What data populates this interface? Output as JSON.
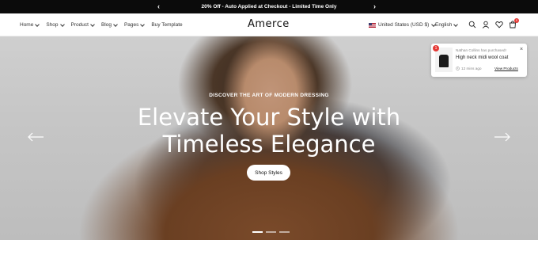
{
  "announcement": {
    "text": "20% Off - Auto Applied at Checkout - Limited Time Only",
    "prev_icon": "chevron-left-icon",
    "next_icon": "chevron-right-icon"
  },
  "nav": {
    "menu": [
      {
        "label": "Home",
        "dropdown": true
      },
      {
        "label": "Shop",
        "dropdown": true
      },
      {
        "label": "Product",
        "dropdown": true
      },
      {
        "label": "Blog",
        "dropdown": true
      },
      {
        "label": "Pages",
        "dropdown": true
      },
      {
        "label": "Buy Template",
        "dropdown": false
      }
    ],
    "logo": "Amerce",
    "currency": "United States (USD $)",
    "language": "English",
    "cart_count": "0",
    "icons": [
      "search-icon",
      "user-icon",
      "heart-icon",
      "cart-icon"
    ]
  },
  "hero": {
    "eyebrow": "DISCOVER THE ART OF MODERN DRESSING",
    "title_line1": "Elevate Your Style with",
    "title_line2": "Timeless Elegance",
    "cta": "Shop Styles",
    "slide_count": 3,
    "active_slide": 1
  },
  "toast": {
    "badge": "1",
    "buyer_line": "Nathan Collins has purchased!",
    "product": "High neck midi wool coat",
    "time_ago": "12 mins ago",
    "view_link": "View Products",
    "close": "×"
  },
  "colors": {
    "announcement_bg": "#0b0b0b",
    "badge": "#e53935"
  }
}
